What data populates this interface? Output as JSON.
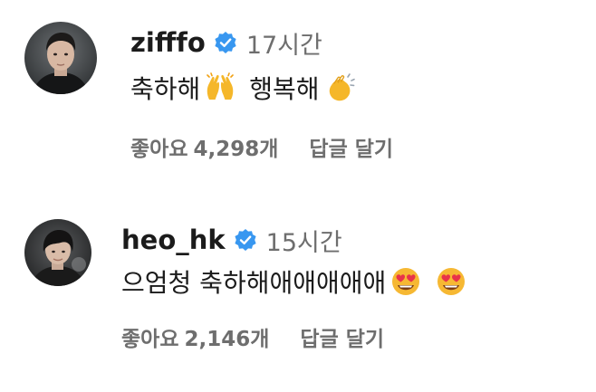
{
  "comments": [
    {
      "username": "zifffo",
      "time": "17시간",
      "text_part1": "축하해",
      "emoji_1": "raising-hands",
      "text_part2": "행복해",
      "emoji_2": "clapping-hands",
      "likes_label": "좋아요",
      "likes_count": "4,298개",
      "reply_label": "답글 달기"
    },
    {
      "username": "heo_hk",
      "time": "15시간",
      "text_part1": "으엄청 축하해애애애애애",
      "emoji_1": "smiling-face-with-heart-eyes",
      "emoji_2": "smiling-face-with-heart-eyes",
      "likes_label": "좋아요",
      "likes_count": "2,146개",
      "reply_label": "답글 달기"
    }
  ],
  "colors": {
    "verified_badge": "#3897f0",
    "secondary_text": "#6e6e6e",
    "primary_text": "#1b1b1b"
  }
}
